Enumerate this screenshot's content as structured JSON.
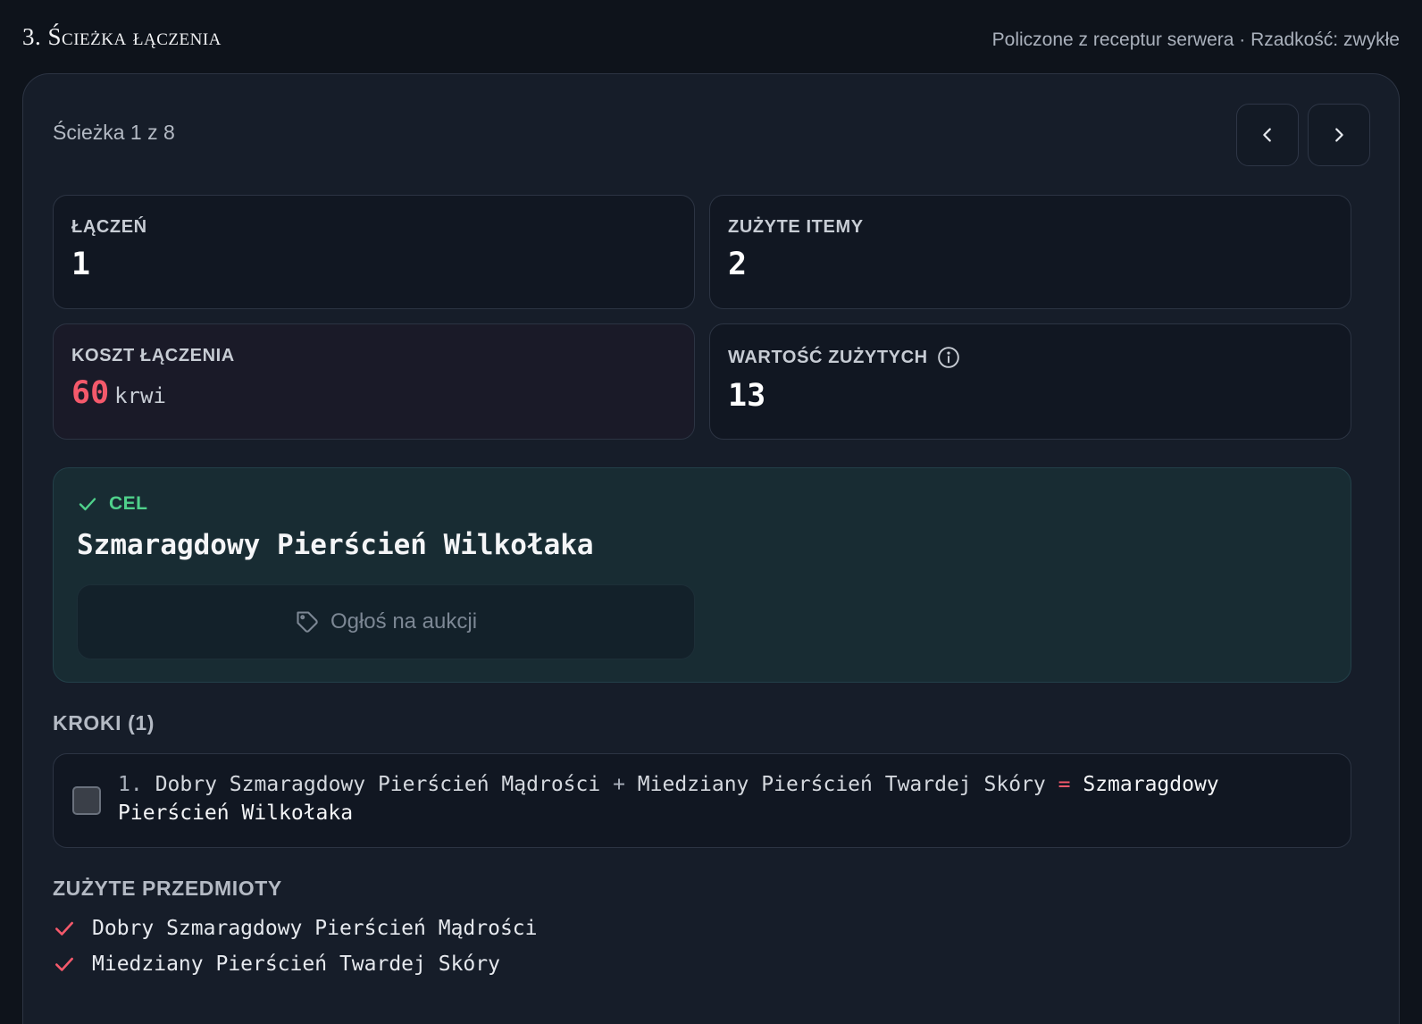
{
  "header": {
    "title": "3. Ścieżka łączenia",
    "meta": "Policzone z receptur serwera · Rzadkość: zwykłe"
  },
  "path": {
    "label": "Ścieżka 1 z 8",
    "prev_icon": "chevron-left-icon",
    "next_icon": "chevron-right-icon"
  },
  "stats": {
    "combines": {
      "label": "ŁĄCZEŃ",
      "value": "1"
    },
    "used_items": {
      "label": "ZUŻYTE ITEMY",
      "value": "2"
    },
    "cost": {
      "label": "KOSZT ŁĄCZENIA",
      "value": "60",
      "unit": "krwi"
    },
    "used_value": {
      "label": "WARTOŚĆ ZUŻYTYCH",
      "value": "13",
      "icon": "info-icon"
    }
  },
  "target": {
    "label": "CEL",
    "name": "Szmaragdowy Pierścień Wilkołaka",
    "auction_button": "Ogłoś na aukcji"
  },
  "steps": {
    "heading": "KROKI (1)",
    "items": [
      {
        "number": "1.",
        "a": "Dobry Szmaragdowy Pierścień Mądrości",
        "plus": "+",
        "b": "Miedziany Pierścień Twardej Skóry",
        "equals": "=",
        "result": "Szmaragdowy Pierścień Wilkołaka"
      }
    ]
  },
  "used": {
    "heading": "ZUŻYTE PRZEDMIOTY",
    "items": [
      "Dobry Szmaragdowy Pierścień Mądrości",
      "Miedziany Pierścień Twardej Skóry"
    ]
  },
  "colors": {
    "accent_green": "#4fd18b",
    "accent_red": "#f4596b",
    "panel": "#161d29",
    "background": "#0e131b"
  }
}
